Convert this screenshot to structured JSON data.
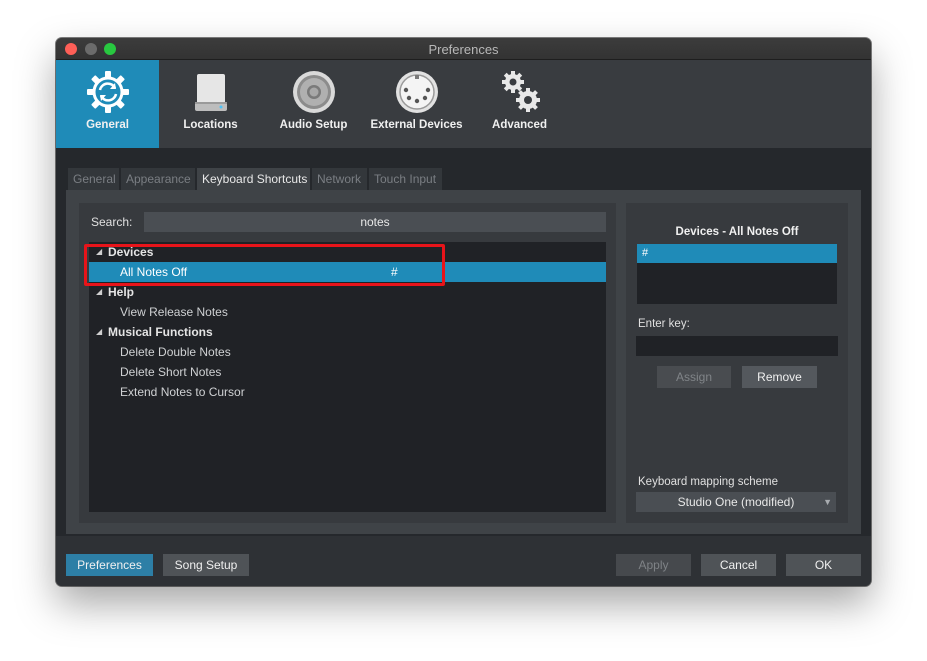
{
  "window": {
    "title": "Preferences"
  },
  "toolbar": {
    "items": [
      {
        "label": "General",
        "icon": "gear-sync-icon",
        "active": true
      },
      {
        "label": "Locations",
        "icon": "drive-icon"
      },
      {
        "label": "Audio Setup",
        "icon": "speaker-icon"
      },
      {
        "label": "External Devices",
        "icon": "midi-port-icon"
      },
      {
        "label": "Advanced",
        "icon": "gears-icon"
      }
    ]
  },
  "tabs": [
    {
      "label": "General"
    },
    {
      "label": "Appearance"
    },
    {
      "label": "Keyboard Shortcuts",
      "active": true
    },
    {
      "label": "Network"
    },
    {
      "label": "Touch Input"
    }
  ],
  "search": {
    "label": "Search:",
    "value": "notes"
  },
  "tree": {
    "groups": [
      {
        "label": "Devices",
        "items": [
          {
            "label": "All Notes Off",
            "key": "#",
            "selected": true
          }
        ]
      },
      {
        "label": "Help",
        "items": [
          {
            "label": "View Release Notes"
          }
        ]
      },
      {
        "label": "Musical Functions",
        "items": [
          {
            "label": "Delete Double Notes"
          },
          {
            "label": "Delete Short Notes"
          },
          {
            "label": "Extend Notes to Cursor"
          }
        ]
      }
    ]
  },
  "shortcut_panel": {
    "title": "Devices - All Notes Off",
    "assigned_key": "#",
    "enter_key_label": "Enter key:",
    "assign_label": "Assign",
    "remove_label": "Remove",
    "scheme_label": "Keyboard mapping scheme",
    "scheme_value": "Studio One (modified)"
  },
  "footer": {
    "preferences_label": "Preferences",
    "song_setup_label": "Song Setup",
    "apply_label": "Apply",
    "cancel_label": "Cancel",
    "ok_label": "OK"
  },
  "colors": {
    "accent": "#1f8bb8",
    "highlight": "#e8141a"
  }
}
